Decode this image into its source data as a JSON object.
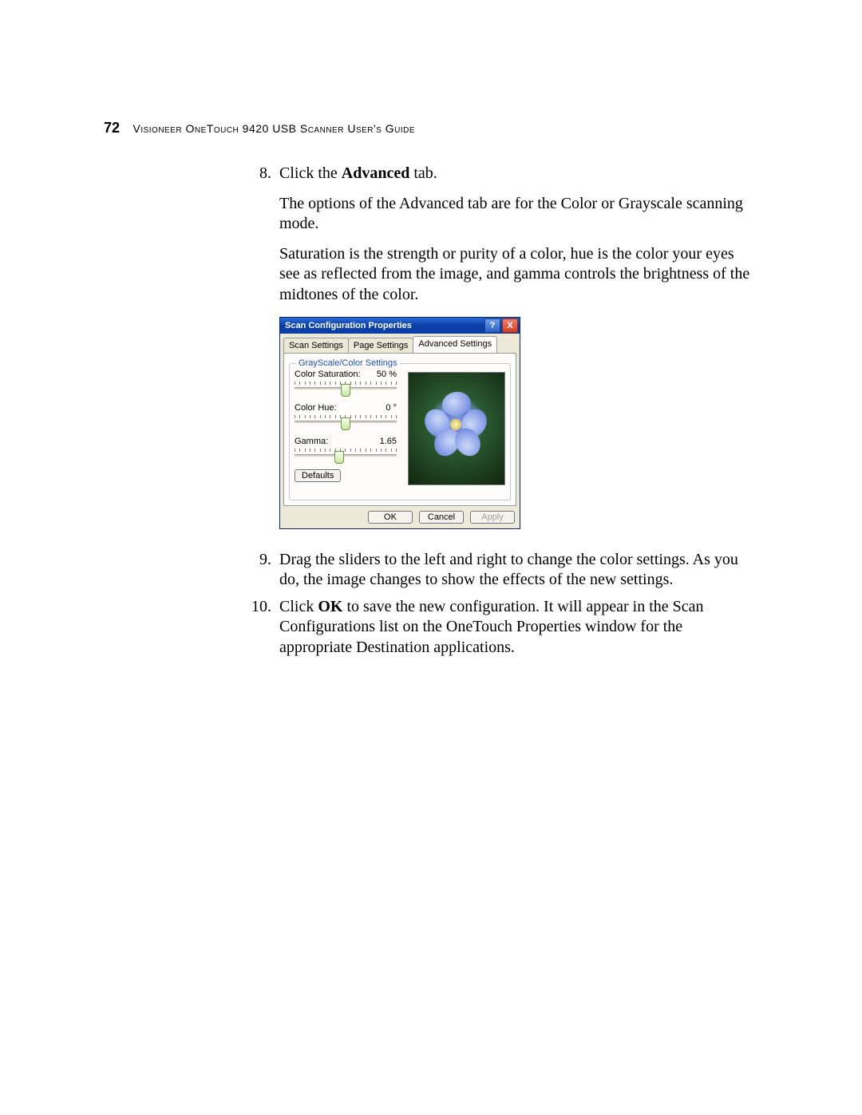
{
  "header": {
    "page_number": "72",
    "doc_title": "Visioneer OneTouch 9420 USB Scanner User's Guide"
  },
  "steps": {
    "s8": {
      "num": "8.",
      "line1_a": "Click the ",
      "line1_bold": "Advanced",
      "line1_b": " tab.",
      "para2": "The options of the Advanced tab are for the Color or Grayscale scanning mode.",
      "para3": "Saturation is the strength or purity of a color, hue is the color your eyes see as reflected from the image, and gamma controls the brightness of the midtones of the color."
    },
    "s9": {
      "num": "9.",
      "text": "Drag the sliders to the left and right to change the color settings. As you do, the image changes to show the effects of the new settings."
    },
    "s10": {
      "num": "10.",
      "a": "Click ",
      "bold": "OK",
      "b": " to save the new configuration. It will appear in the Scan Configurations list on the OneTouch Properties window for the appropriate Destination applications."
    }
  },
  "dialog": {
    "title": "Scan Configuration Properties",
    "help_symbol": "?",
    "close_symbol": "X",
    "tabs": {
      "scan": "Scan Settings",
      "page": "Page Settings",
      "advanced": "Advanced Settings"
    },
    "group_label": "GrayScale/Color Settings",
    "sliders": {
      "saturation": {
        "label": "Color Saturation:",
        "value": "50 %",
        "pos": 50
      },
      "hue": {
        "label": "Color Hue:",
        "value": "0 °",
        "pos": 50
      },
      "gamma": {
        "label": "Gamma:",
        "value": "1.65",
        "pos": 44
      }
    },
    "defaults": "Defaults",
    "buttons": {
      "ok": "OK",
      "cancel": "Cancel",
      "apply": "Apply"
    }
  }
}
